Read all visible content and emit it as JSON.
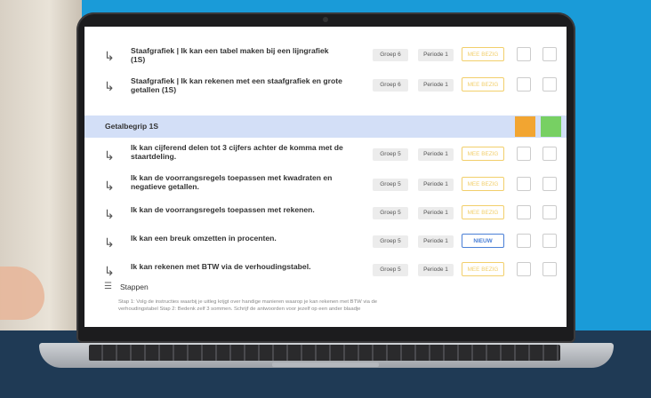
{
  "rows": [
    {
      "text": "Staafgrafiek | Ik kan een tabel maken bij een lijngrafiek (1S)",
      "groep": "Groep 6",
      "periode": "Periode 1",
      "status": "MEE BEZIG"
    },
    {
      "text": "Staafgrafiek | Ik kan rekenen met een staafgrafiek en grote getallen (1S)",
      "groep": "Groep 6",
      "periode": "Periode 1",
      "status": "MEE BEZIG"
    }
  ],
  "section": {
    "title": "Getalbegrip 1S"
  },
  "rows2": [
    {
      "text": "Ik kan cijferend delen tot 3 cijfers achter de komma met de staartdeling.",
      "groep": "Groep 5",
      "periode": "Periode 1",
      "status": "MEE BEZIG"
    },
    {
      "text": "Ik kan de voorrangsregels toepassen met kwadraten en negatieve getallen.",
      "groep": "Groep 5",
      "periode": "Periode 1",
      "status": "MEE BEZIG"
    },
    {
      "text": "Ik kan de voorrangsregels toepassen met rekenen.",
      "groep": "Groep 5",
      "periode": "Periode 1",
      "status": "MEE BEZIG"
    },
    {
      "text": "Ik kan een breuk omzetten in procenten.",
      "groep": "Groep 5",
      "periode": "Periode 1",
      "status": "NIEUW"
    },
    {
      "text": "Ik kan rekenen met BTW via de verhoudingstabel.",
      "groep": "Groep 5",
      "periode": "Periode 1",
      "status": "MEE BEZIG"
    }
  ],
  "steps": {
    "title": "Stappen",
    "text": "Stap 1: Volg de instructies waarbij je uitleg krijgt over handige manieren waarop je kan rekenen met BTW via de verhoudingstabel Stap 2: Bedenk zelf 3 sommen. Schrijf de antwoorden voor jezelf op een ander blaadje"
  },
  "colors": {
    "accent": "#1a9bd8",
    "section_bg": "#d3dff7",
    "status_orange": "#f2a531",
    "status_green": "#77d063"
  }
}
